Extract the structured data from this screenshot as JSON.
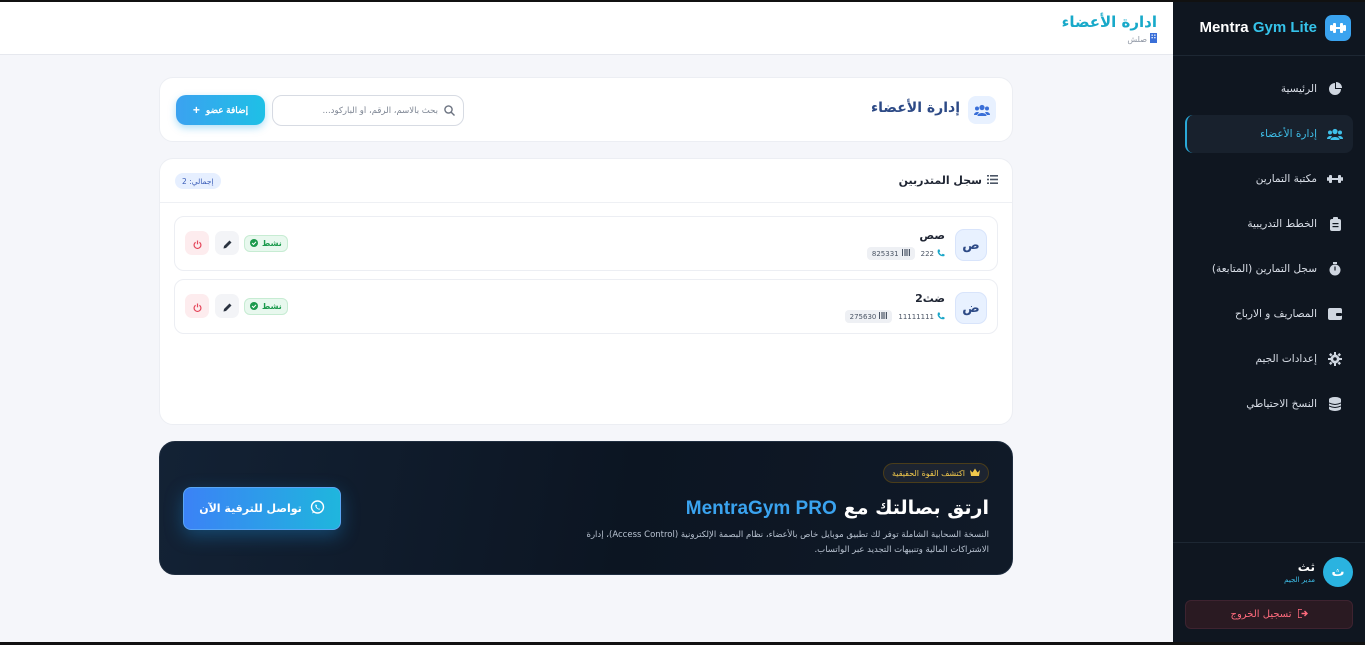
{
  "app": {
    "brand_part1": "Mentra",
    "brand_part2": "Gym Lite"
  },
  "sidebar": {
    "items": [
      {
        "label": "الرئيسية",
        "icon": "pie-chart-icon",
        "active": false
      },
      {
        "label": "إدارة الأعضاء",
        "icon": "users-icon",
        "active": true
      },
      {
        "label": "مكتبة التمارين",
        "icon": "dumbbell-icon",
        "active": false
      },
      {
        "label": "الخطط التدريبية",
        "icon": "clipboard-icon",
        "active": false
      },
      {
        "label": "سجل التمارين (المتابعة)",
        "icon": "stopwatch-icon",
        "active": false
      },
      {
        "label": "المصاريف و الارباح",
        "icon": "wallet-icon",
        "active": false
      },
      {
        "label": "إعدادات الجيم",
        "icon": "gear-icon",
        "active": false
      },
      {
        "label": "النسخ الاحتياطي",
        "icon": "database-icon",
        "active": false
      }
    ],
    "user": {
      "initial": "ث",
      "name": "ثث",
      "role": "مدير الجيم"
    },
    "logout_label": "تسجيل الخروج"
  },
  "topbar": {
    "title": "ادارة الأعضاء",
    "subtitle": "صلش"
  },
  "header": {
    "title": "إدارة الأعضاء",
    "search_placeholder": "بحث بالاسم، الرقم، أو الباركود...",
    "add_label": "إضافة عضو"
  },
  "members": {
    "title": "سجل المتدربين",
    "total": "إجمالي: 2",
    "rows": [
      {
        "initial": "ص",
        "name": "صص",
        "phone": "222",
        "barcode": "825331",
        "status": "نشط"
      },
      {
        "initial": "ض",
        "name": "ضث2",
        "phone": "11111111",
        "barcode": "275630",
        "status": "نشط"
      }
    ]
  },
  "promo": {
    "pill": "اكتشف القوة الحقيقية",
    "title_prefix": "ارتق بصالتك مع",
    "title_brand": "MentraGym PRO",
    "description": "النسخة السحابية الشاملة توفر لك تطبيق موبايل خاص بالأعضاء، نظام البصمة الإلكترونية (Access Control)، إدارة الاشتراكات المالية وتنبيهات التجديد عبر الواتساب.",
    "button_label": "تواصل للترقية الآن"
  },
  "colors": {
    "accent": "#18a9c9",
    "sidebar_bg": "#0f1620",
    "status_active": "#1b9a4c",
    "danger": "#ff6b7d"
  }
}
